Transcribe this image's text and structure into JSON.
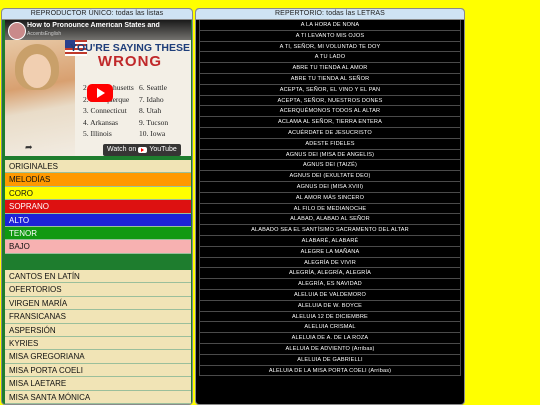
{
  "left_panel": {
    "header": "REPRODUCTOR ÚNICO: todas las listas",
    "video": {
      "title": "How to Pronounce American States and ",
      "channel": "AccentsEnglish",
      "headline_line1": "YOU'RE SAYING THESE",
      "headline_line2": "WRONG",
      "states": [
        "2. Massachusetts",
        "6. Seattle",
        "2. Albuquerque",
        "7. Idaho",
        "3. Connecticut",
        "8. Utah",
        "4. Arkansas",
        "9. Tucson",
        "5. Illinois",
        "10. Iowa"
      ],
      "watch_on": "Watch on",
      "watch_brand": "YouTube"
    },
    "lists_a": [
      {
        "label": "ORIGINALES",
        "bg": "#f1e4b6"
      },
      {
        "label": "MELODÍAS",
        "bg": "#ff9900"
      },
      {
        "label": "CORO",
        "bg": "#ffff00"
      },
      {
        "label": "SOPRANO",
        "bg": "#dd1111"
      },
      {
        "label": "ALTO",
        "bg": "#1d22d8"
      },
      {
        "label": "TENOR",
        "bg": "#119911"
      },
      {
        "label": "BAJO",
        "bg": "#f7b1b1"
      }
    ],
    "lists_b": [
      {
        "label": "CANTOS EN LATÍN",
        "bg": "#f1e4b6"
      },
      {
        "label": "OFERTORIOS",
        "bg": "#f1e4b6"
      },
      {
        "label": "VIRGEN MARÍA",
        "bg": "#f1e4b6"
      },
      {
        "label": "FRANSICANAS",
        "bg": "#f1e4b6"
      },
      {
        "label": "ASPERSIÓN",
        "bg": "#f1e4b6"
      },
      {
        "label": "KYRIES",
        "bg": "#f1e4b6"
      },
      {
        "label": "MISA GREGORIANA",
        "bg": "#f1e4b6"
      },
      {
        "label": "MISA PORTA COELI",
        "bg": "#f1e4b6"
      },
      {
        "label": "MISA LAETARE",
        "bg": "#f1e4b6"
      },
      {
        "label": "MISA SANTA MÓNICA",
        "bg": "#f1e4b6"
      }
    ]
  },
  "right_panel": {
    "header": "REPERTORIO: todas las LETRAS",
    "songs": [
      "A LA HORA DE NONA",
      "A TI LEVANTO MIS OJOS",
      "A TI, SEÑOR, MI VOLUNTAD TE DOY",
      "A TU LADO",
      "ABRE TU TIENDA AL AMOR",
      "ABRE TU TIENDA AL SEÑOR",
      "ACEPTA, SEÑOR, EL VINO Y EL PAN",
      "ACEPTA, SEÑOR, NUESTROS DONES",
      "ACERQUÉMONOS TODOS AL ALTAR",
      "ACLAMA AL SEÑOR, TIERRA ENTERA",
      "ACUÉRDATE DE JESUCRISTO",
      "ADESTE FIDELES",
      "AGNUS DEI (MISA DE ANGELIS)",
      "AGNUS DEI (TAIZÉ)",
      "AGNUS DEI (EXULTATE DEO)",
      "AGNUS DEI (MISA XVIII)",
      "AL AMOR MÁS SINCERO",
      "AL FILO DE MEDIANOCHE",
      "ALABAD, ALABAD AL SEÑOR",
      "ALABADO SEA EL SANTÍSIMO SACRAMENTO DEL ALTAR",
      "ALABARÉ, ALABARÉ",
      "ALEGRE LA MAÑANA",
      "ALEGRÍA DE VIVIR",
      "ALEGRÍA, ALEGRÍA, ALEGRÍA",
      "ALEGRÍA, ES NAVIDAD",
      "ALELUIA DE VALDEMORO",
      "ALELUIA DE W. BOYCE",
      "ALELUIA 12 DE DICIEMBRE",
      "ALELUIA CRISMAL",
      "ALELUIA DE A. DE LA ROZA",
      "ALELUIA DE ADVIENTO (Arribas)",
      "ALELUIA DE GABRIELLI",
      "ALELUIA DE LA MISA PORTA COELI (Arribas)"
    ]
  }
}
